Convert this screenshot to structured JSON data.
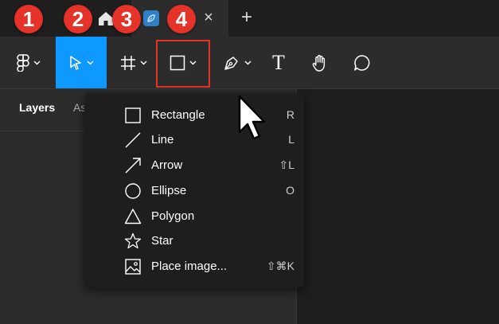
{
  "tabs": {
    "close_symbol": "×",
    "new_tab_symbol": "+"
  },
  "toolbar": {
    "text_tool_glyph": "T",
    "active_color": "#0d99ff",
    "highlight_color": "#e5332a"
  },
  "panel": {
    "layers_tab": "Layers",
    "assets_tab": "As"
  },
  "shape_menu": {
    "items": [
      {
        "label": "Rectangle",
        "shortcut": "R",
        "icon": "rectangle-icon"
      },
      {
        "label": "Line",
        "shortcut": "L",
        "icon": "line-icon"
      },
      {
        "label": "Arrow",
        "shortcut": "⇧L",
        "icon": "arrow-icon"
      },
      {
        "label": "Ellipse",
        "shortcut": "O",
        "icon": "ellipse-icon"
      },
      {
        "label": "Polygon",
        "shortcut": "",
        "icon": "polygon-icon"
      },
      {
        "label": "Star",
        "shortcut": "",
        "icon": "star-icon"
      },
      {
        "label": "Place image...",
        "shortcut": "⇧⌘K",
        "icon": "image-icon"
      }
    ]
  },
  "annotations": {
    "steps": [
      "1",
      "2",
      "3",
      "4"
    ],
    "badge_color": "#e5332a"
  }
}
